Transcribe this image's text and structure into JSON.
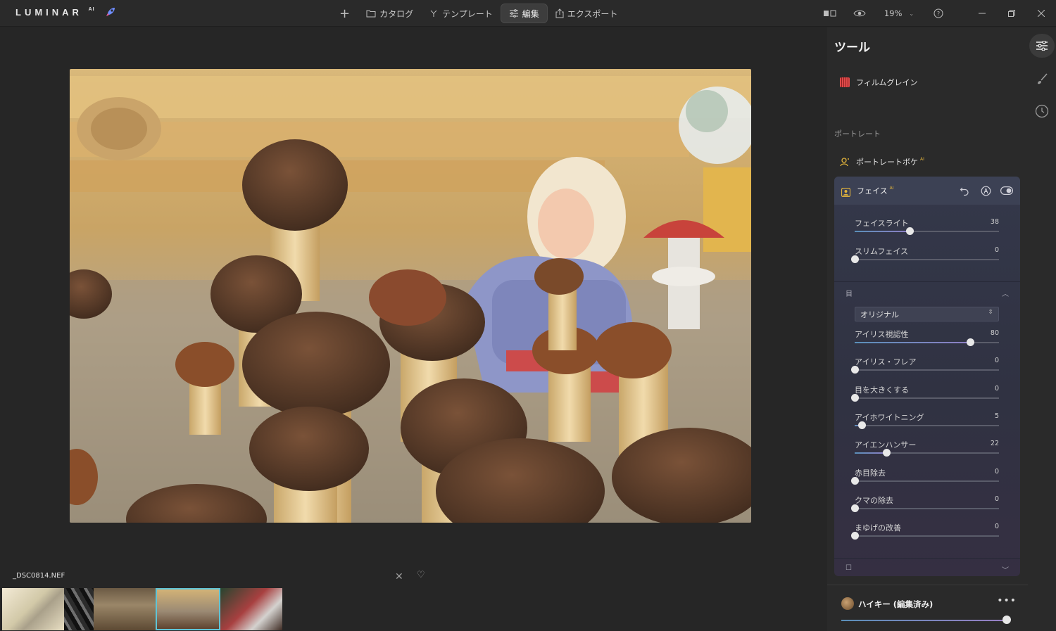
{
  "app": {
    "logo": "LUMINAR",
    "logo_sup": "AI"
  },
  "toolbar": {
    "add_label": "+",
    "catalog_label": "カタログ",
    "templates_label": "テンプレート",
    "edit_label": "編集",
    "export_label": "エクスポート",
    "zoom": "19%"
  },
  "panel": {
    "title": "ツール",
    "film_grain": "フィルムグレイン",
    "portrait_section": "ポートレート",
    "portrait_bokeh": "ポートレートボケ",
    "ai_badge": "AI",
    "face": {
      "title": "フェイス",
      "ai_badge": "AI",
      "sliders": [
        {
          "label": "フェイスライト",
          "value": "38",
          "fraction": 0.38
        },
        {
          "label": "スリムフェイス",
          "value": "0",
          "fraction": 0
        }
      ],
      "eye_section_label": "目",
      "eye_preset": "オリジナル",
      "eye_sliders": [
        {
          "label": "アイリス視認性",
          "value": "80",
          "fraction": 0.8
        },
        {
          "label": "アイリス・フレア",
          "value": "0",
          "fraction": 0
        },
        {
          "label": "目を大きくする",
          "value": "0",
          "fraction": 0
        },
        {
          "label": "アイホワイトニング",
          "value": "5",
          "fraction": 0.05
        },
        {
          "label": "アイエンハンサー",
          "value": "22",
          "fraction": 0.22
        },
        {
          "label": "赤目除去",
          "value": "0",
          "fraction": 0
        },
        {
          "label": "クマの除去",
          "value": "0",
          "fraction": 0
        },
        {
          "label": "まゆげの改善",
          "value": "0",
          "fraction": 0
        }
      ]
    },
    "preset_name": "ハイキー (編集済み)",
    "preset_amount_fraction": 0.98
  },
  "filmstrip": {
    "filename": "_DSC0814.NEF"
  },
  "colors": {
    "accent_selected": "#5fc4d6",
    "slider_fill_start": "#5a8fb9",
    "slider_fill_end": "#8e7fc4"
  }
}
